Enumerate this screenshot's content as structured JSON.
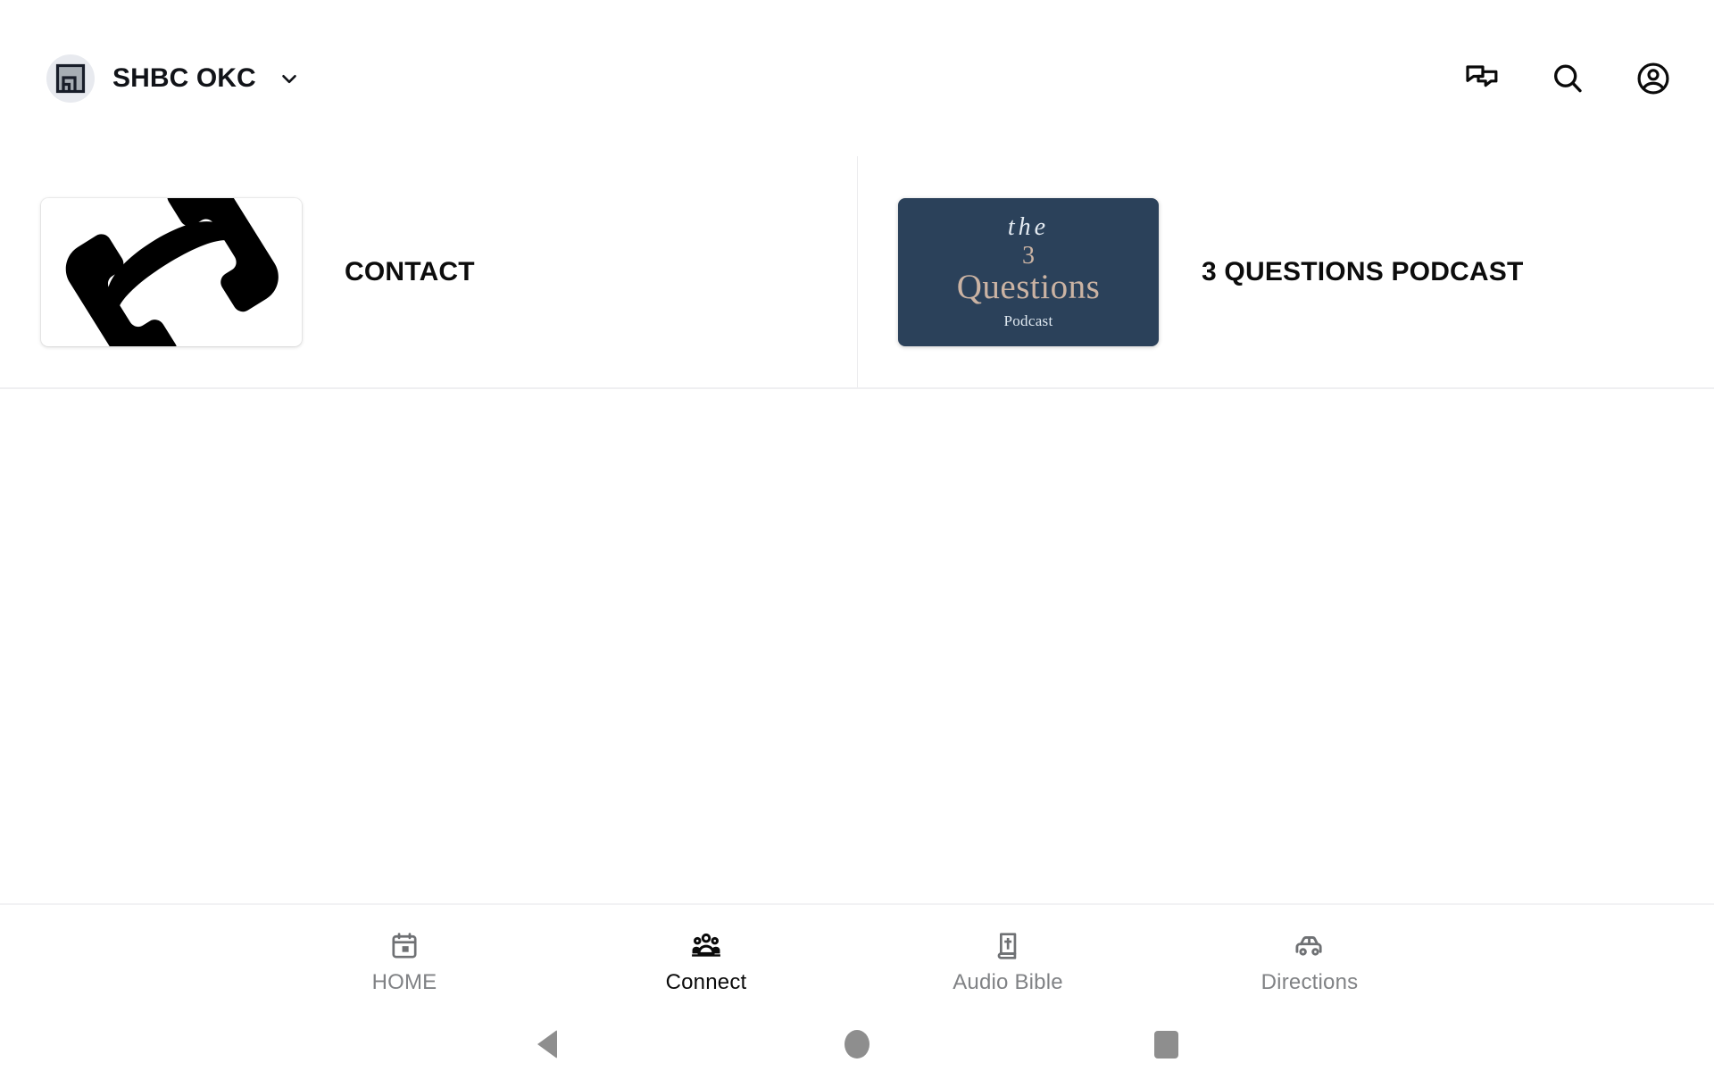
{
  "app": {
    "brand_name": "SHBC OKC",
    "brand_logo_icon": "church-app-logo-icon",
    "brand_chevron_icon": "chevron-down-icon"
  },
  "appbar": {
    "actions": [
      {
        "name": "messages-icon",
        "label": "Messages"
      },
      {
        "name": "search-icon",
        "label": "Search"
      },
      {
        "name": "account-icon",
        "label": "Account"
      }
    ]
  },
  "main": {
    "tiles": [
      {
        "label": "CONTACT",
        "thumb_type": "image",
        "thumb_icon": "telephone-handset-icon",
        "thumb_bg": "#ffffff"
      },
      {
        "label": "3 QUESTIONS PODCAST",
        "thumb_type": "artwork",
        "thumb_bg": "#2b415a",
        "artwork": {
          "line1": "the",
          "line2": "3",
          "line3": "Questions",
          "line4": "Podcast",
          "accent_color": "#cbb3a3",
          "text_color": "#e4ebf2"
        }
      }
    ]
  },
  "tabbar": {
    "active_index": 1,
    "tabs": [
      {
        "label": "HOME",
        "icon": "calendar-today-icon",
        "active": false
      },
      {
        "label": "Connect",
        "icon": "people-group-icon",
        "active": true
      },
      {
        "label": "Audio Bible",
        "icon": "bible-book-icon",
        "active": false
      },
      {
        "label": "Directions",
        "icon": "car-icon",
        "active": false
      }
    ]
  },
  "system_nav": {
    "buttons": [
      {
        "name": "android-back-button",
        "label": "Back"
      },
      {
        "name": "android-home-button",
        "label": "Home"
      },
      {
        "name": "android-recents-button",
        "label": "Recent apps"
      }
    ]
  },
  "colors": {
    "background": "#ffffff",
    "text_primary": "#111318",
    "text_muted": "#808285",
    "divider": "#ececee",
    "podcast_navy": "#2b415a",
    "podcast_tan": "#cbb3a3",
    "system_gray": "#8e8e8e"
  }
}
